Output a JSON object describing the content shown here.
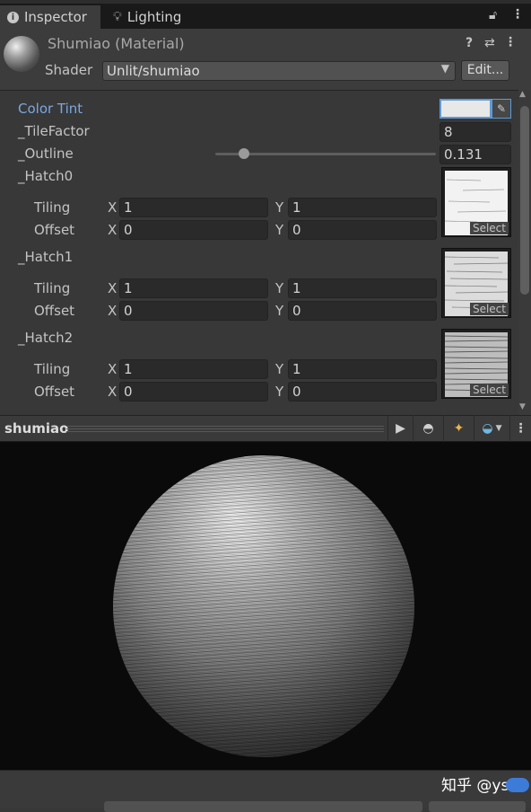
{
  "tabs": [
    {
      "label": "Inspector",
      "icon": "info-icon",
      "active": true
    },
    {
      "label": "Lighting",
      "icon": "lightbulb-icon",
      "active": false
    }
  ],
  "material": {
    "title": "Shumiao (Material)",
    "shader_label": "Shader",
    "shader_value": "Unlit/shumiao",
    "edit_label": "Edit..."
  },
  "properties": {
    "color_tint": {
      "label": "Color Tint",
      "color": "#e8e8e8"
    },
    "tile_factor": {
      "label": "_TileFactor",
      "value": "8"
    },
    "outline": {
      "label": "_Outline",
      "value": "0.131",
      "slider_fraction": 0.131
    },
    "hatches": [
      {
        "label": "_Hatch0",
        "tiling_label": "Tiling",
        "offset_label": "Offset",
        "tiling_x": "1",
        "tiling_y": "1",
        "offset_x": "0",
        "offset_y": "0",
        "select_label": "Select"
      },
      {
        "label": "_Hatch1",
        "tiling_label": "Tiling",
        "offset_label": "Offset",
        "tiling_x": "1",
        "tiling_y": "1",
        "offset_x": "0",
        "offset_y": "0",
        "select_label": "Select"
      },
      {
        "label": "_Hatch2",
        "tiling_label": "Tiling",
        "offset_label": "Offset",
        "tiling_x": "1",
        "tiling_y": "1",
        "offset_x": "0",
        "offset_y": "0",
        "select_label": "Select"
      }
    ],
    "axis_x": "X",
    "axis_y": "Y"
  },
  "preview": {
    "title": "shumiao",
    "background": "#0a0a0a"
  },
  "watermark": "知乎 @ys",
  "colors": {
    "accent": "#5e9bd6",
    "panel": "#383838",
    "field": "#2a2a2a"
  }
}
